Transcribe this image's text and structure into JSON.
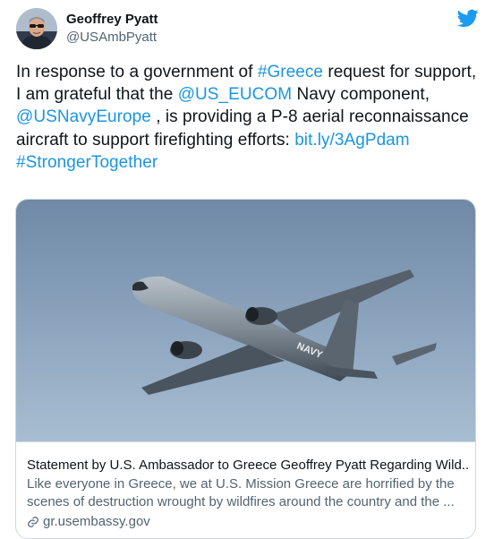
{
  "author": {
    "display_name": "Geoffrey Pyatt",
    "handle": "@USAmbPyatt"
  },
  "tweet": {
    "seg1": "In response to a government of ",
    "hashtag_greece": "#Greece",
    "seg2": " request for support, I am grateful that the ",
    "mention_eucom": "@US_EUCOM",
    "seg3": " Navy component, ",
    "mention_navy": "@USNavyEurope",
    "seg4": " , is providing a P-8 aerial reconnaissance aircraft to support firefighting efforts: ",
    "link": "bit.ly/3AgPdam",
    "hashtag_stronger": "#StrongerTogether"
  },
  "card": {
    "title": "Statement by U.S. Ambassador to Greece Geoffrey Pyatt Regarding Wild...",
    "description_line1": "Like everyone in Greece, we at U.S. Mission Greece are horrified by the",
    "description_line2": "scenes of destruction wrought by wildfires around the country and the ...",
    "domain": "gr.usembassy.gov",
    "aircraft_marking": "NAVY"
  },
  "icons": {
    "brand": "twitter-bird-icon",
    "link": "link-icon"
  },
  "colors": {
    "link": "#1b95e0",
    "brand": "#1d9bf0",
    "secondary_text": "#536471",
    "border": "#cfd9de"
  }
}
